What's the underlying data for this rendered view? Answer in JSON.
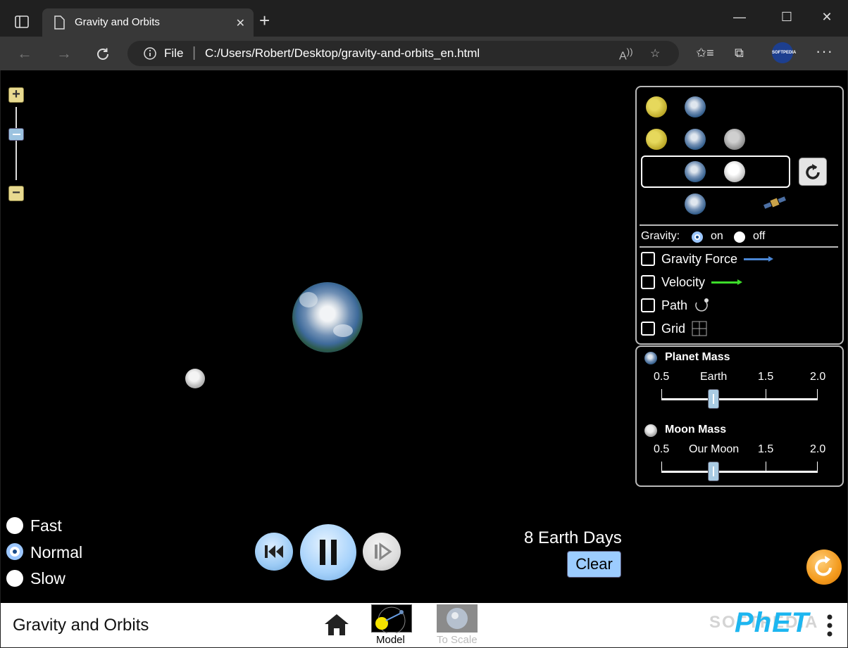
{
  "browser": {
    "tab_title": "Gravity and Orbits",
    "address_prefix": "File",
    "url": "C:/Users/Robert/Desktop/gravity-and-orbits_en.html",
    "profile_text": "SOFTPEDIA"
  },
  "sim": {
    "screen_title": "Gravity and Orbits",
    "gravity_label": "Gravity:",
    "gravity_on": "on",
    "gravity_off": "off",
    "gravity_selected": "on",
    "checkboxes": {
      "gravity_force": "Gravity Force",
      "velocity": "Velocity",
      "path": "Path",
      "grid": "Grid"
    },
    "planet_mass": {
      "title": "Planet Mass",
      "ticks": [
        "0.5",
        "Earth",
        "1.5",
        "2.0"
      ],
      "value": 1.0
    },
    "moon_mass": {
      "title": "Moon Mass",
      "ticks": [
        "0.5",
        "Our Moon",
        "1.5",
        "2.0"
      ],
      "value": 1.0
    },
    "speed": {
      "fast": "Fast",
      "normal": "Normal",
      "slow": "Slow",
      "selected": "Normal"
    },
    "elapsed_time": "8 Earth Days",
    "clear_label": "Clear"
  },
  "navbar": {
    "screens": [
      {
        "label": "Model",
        "selected": true
      },
      {
        "label": "To Scale",
        "selected": false
      }
    ],
    "logo": "PhET",
    "watermark": "SOFTPEDIA"
  },
  "colors": {
    "gravity_force_arrow": "#4a86d4",
    "velocity_arrow": "#3ddc2a",
    "button_blue": "#9cccff",
    "reset_orange": "#f39a1d",
    "zoom_yellow": "#e8da90"
  }
}
